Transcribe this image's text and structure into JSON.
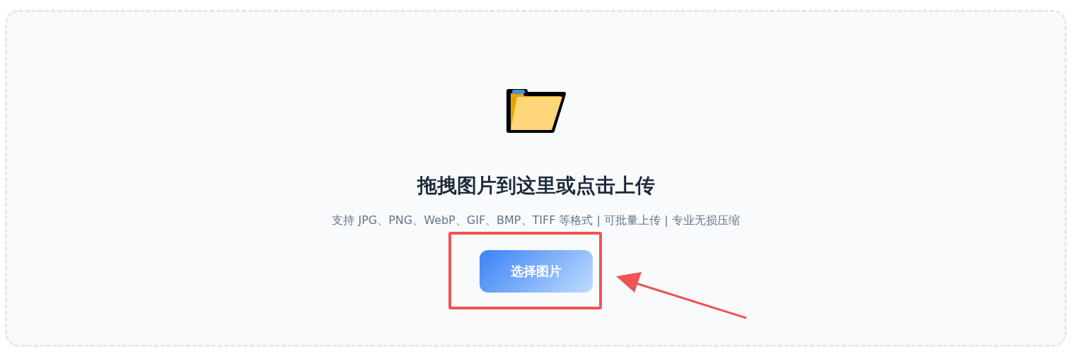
{
  "dropzone": {
    "title": "拖拽图片到这里或点击上传",
    "subtitle": "支持 JPG、PNG、WebP、GIF、BMP、TIFF 等格式 | 可批量上传 | 专业无损压缩",
    "button": "选择图片"
  }
}
